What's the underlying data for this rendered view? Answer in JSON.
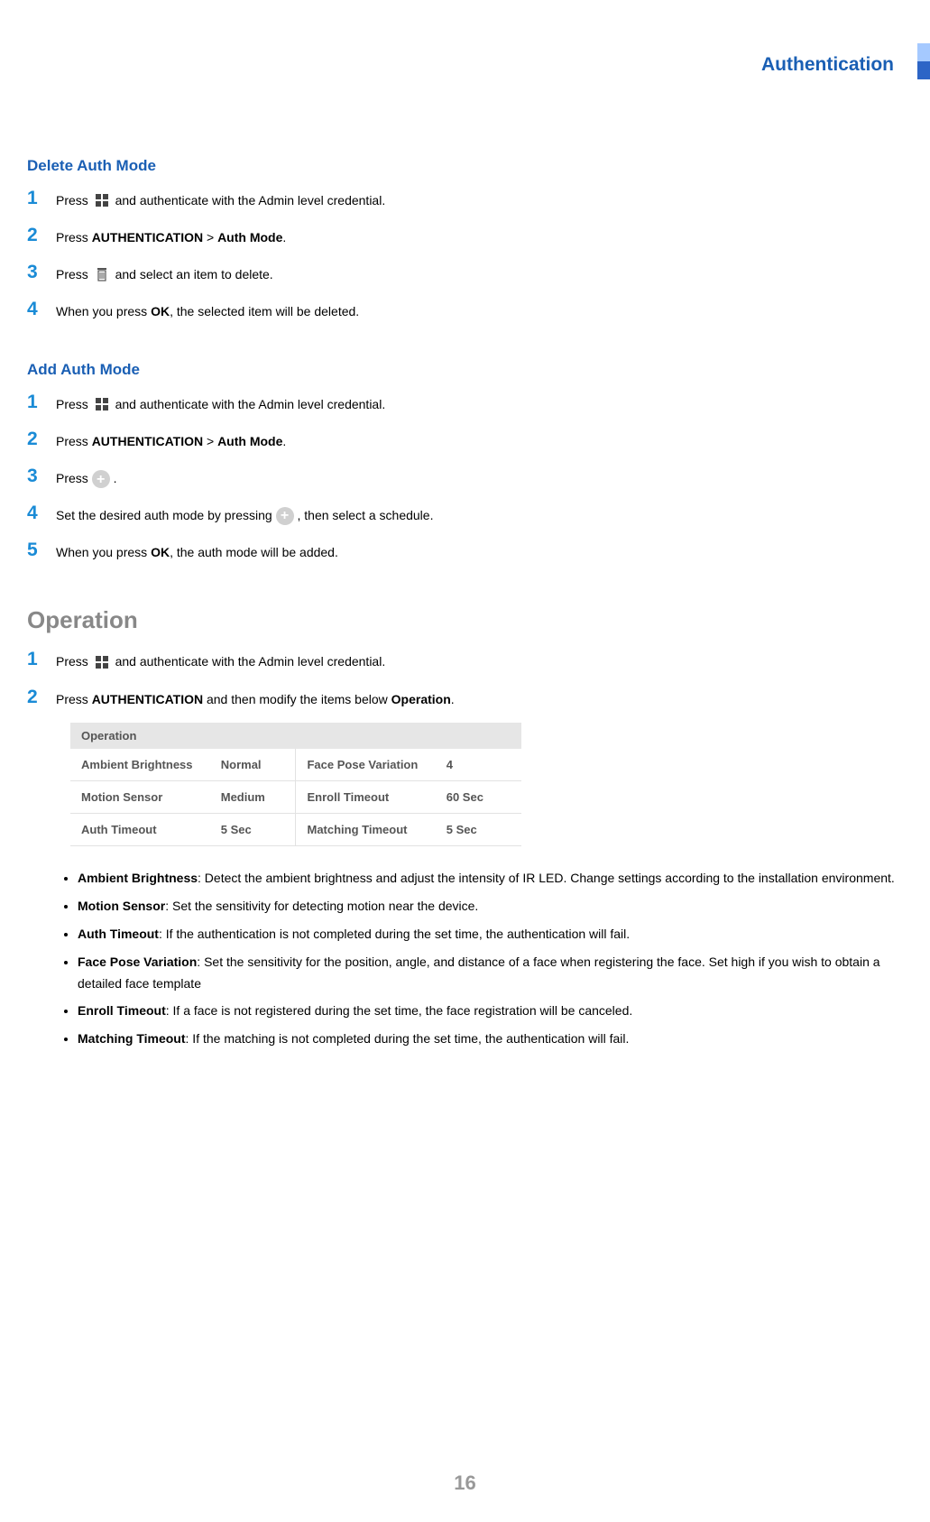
{
  "header": "Authentication",
  "pageNumber": "16",
  "deleteSection": {
    "title": "Delete  Auth  Mode",
    "steps": [
      {
        "n": "1",
        "pre": "Press ",
        "post": " and authenticate with the Admin level credential."
      },
      {
        "n": "2",
        "pre": "Press ",
        "b1": "AUTHENTICATION",
        "mid1": " > ",
        "b2": "Auth Mode",
        "post": "."
      },
      {
        "n": "3",
        "pre": "Press ",
        "post": " and select an item to delete."
      },
      {
        "n": "4",
        "pre": "When you press ",
        "b1": "OK",
        "post": ", the selected item will be deleted."
      }
    ]
  },
  "addSection": {
    "title": "Add  Auth  Mode",
    "steps": [
      {
        "n": "1",
        "pre": "Press ",
        "post": " and authenticate with the Admin level credential."
      },
      {
        "n": "2",
        "pre": "Press ",
        "b1": "AUTHENTICATION",
        "mid1": " > ",
        "b2": "Auth Mode",
        "post": "."
      },
      {
        "n": "3",
        "pre": "Press ",
        "post": "."
      },
      {
        "n": "4",
        "pre": "Set the desired auth mode by pressing ",
        "post": ", then select a schedule."
      },
      {
        "n": "5",
        "pre": "When you press ",
        "b1": "OK",
        "post": ", the auth mode will be added."
      }
    ]
  },
  "operationSection": {
    "title": "Operation",
    "steps": [
      {
        "n": "1",
        "pre": "Press ",
        "post": " and authenticate with the Admin level credential."
      },
      {
        "n": "2",
        "pre": "Press ",
        "b1": "AUTHENTICATION",
        "mid1": " and then modify the items below ",
        "b2": "Operation",
        "post": "."
      }
    ],
    "tableHeader": "Operation",
    "rows": [
      {
        "l1": "Ambient Brightness",
        "v1": "Normal",
        "l2": "Face Pose Variation",
        "v2": "4"
      },
      {
        "l1": "Motion Sensor",
        "v1": "Medium",
        "l2": "Enroll Timeout",
        "v2": "60 Sec"
      },
      {
        "l1": "Auth Timeout",
        "v1": "5 Sec",
        "l2": "Matching Timeout",
        "v2": "5 Sec"
      }
    ],
    "bullets": [
      {
        "label": "Ambient Brightness",
        "text": ": Detect the ambient brightness and adjust the intensity of IR LED.  Change settings according to the installation environment."
      },
      {
        "label": "Motion Sensor",
        "text": ": Set the sensitivity for detecting motion near the device."
      },
      {
        "label": "Auth Timeout",
        "text": ": If the authentication is not completed during the set time, the authentication will fail."
      },
      {
        "label": "Face Pose Variation",
        "text": ": Set the sensitivity for the position, angle, and distance of a face when registering the face. Set high if you wish to obtain a detailed face template"
      },
      {
        "label": "Enroll Timeout",
        "text": ": If a face is not registered during the set time, the face registration will be canceled."
      },
      {
        "label": "Matching Timeout",
        "text": ": If the matching is not completed during the set time, the authentication will fail."
      }
    ]
  }
}
